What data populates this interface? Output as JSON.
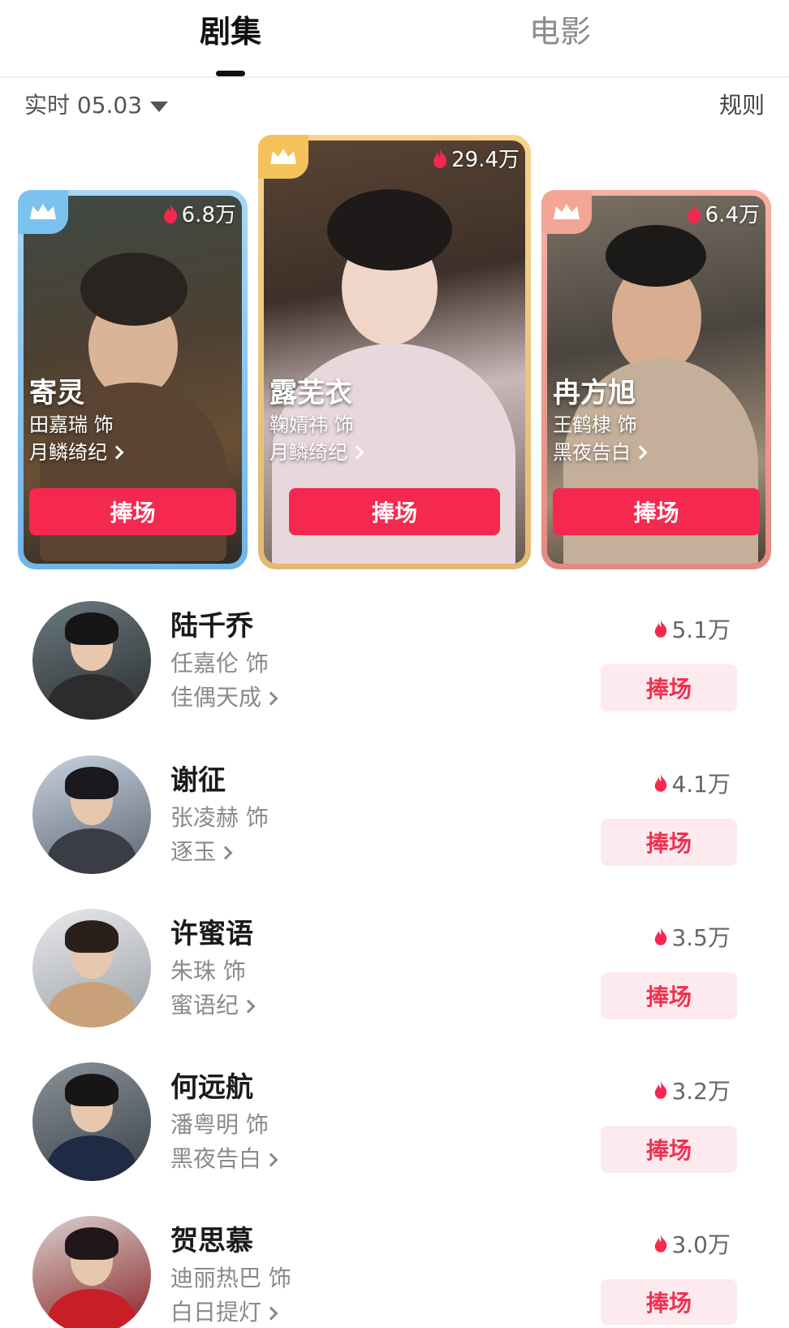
{
  "tabs": [
    {
      "label": "剧集",
      "active": true
    },
    {
      "label": "电影",
      "active": false
    }
  ],
  "filter": {
    "label": "实时 05.03",
    "rules": "规则"
  },
  "accent_color": "#f5284f",
  "top3": [
    {
      "rank": 2,
      "heat": "6.8万",
      "name": "寄灵",
      "actor": "田嘉瑞 饰",
      "show": "月鳞绮纪",
      "button": "捧场",
      "frame": "blue"
    },
    {
      "rank": 1,
      "heat": "29.4万",
      "name": "露芜衣",
      "actor": "鞠婧祎 饰",
      "show": "月鳞绮纪",
      "button": "捧场",
      "frame": "gold"
    },
    {
      "rank": 3,
      "heat": "6.4万",
      "name": "冉方旭",
      "actor": "王鹤棣 饰",
      "show": "黑夜告白",
      "button": "捧场",
      "frame": "pink"
    }
  ],
  "list": [
    {
      "name": "陆千乔",
      "actor": "任嘉伦 饰",
      "show": "佳偶天成",
      "heat": "5.1万",
      "button": "捧场"
    },
    {
      "name": "谢征",
      "actor": "张凌赫 饰",
      "show": "逐玉",
      "heat": "4.1万",
      "button": "捧场"
    },
    {
      "name": "许蜜语",
      "actor": "朱珠 饰",
      "show": "蜜语纪",
      "heat": "3.5万",
      "button": "捧场"
    },
    {
      "name": "何远航",
      "actor": "潘粤明 饰",
      "show": "黑夜告白",
      "heat": "3.2万",
      "button": "捧场"
    },
    {
      "name": "贺思慕",
      "actor": "迪丽热巴 饰",
      "show": "白日提灯",
      "heat": "3.0万",
      "button": "捧场"
    }
  ]
}
